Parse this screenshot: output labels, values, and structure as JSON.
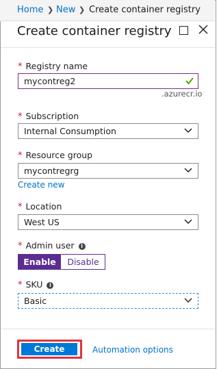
{
  "breadcrumb": {
    "home": "Home",
    "new": "New",
    "current": "Create container registry"
  },
  "blade": {
    "title": "Create container registry"
  },
  "form": {
    "registry_name": {
      "label": "Registry name",
      "value": "mycontreg2",
      "suffix": ".azurecr.io",
      "valid": true
    },
    "subscription": {
      "label": "Subscription",
      "value": "Internal Consumption"
    },
    "resource_group": {
      "label": "Resource group",
      "value": "mycontregrg",
      "create_new": "Create new"
    },
    "location": {
      "label": "Location",
      "value": "West US"
    },
    "admin_user": {
      "label": "Admin user",
      "enable": "Enable",
      "disable": "Disable",
      "selected": "Enable"
    },
    "sku": {
      "label": "SKU",
      "value": "Basic"
    }
  },
  "footer": {
    "create": "Create",
    "automation": "Automation options"
  },
  "colors": {
    "link": "#0072c6",
    "required": "#c5212a",
    "toggle_accent": "#5c2d91",
    "primary_button": "#0078d7",
    "highlight_outline": "#e0333e",
    "valid_check": "#57a300"
  }
}
